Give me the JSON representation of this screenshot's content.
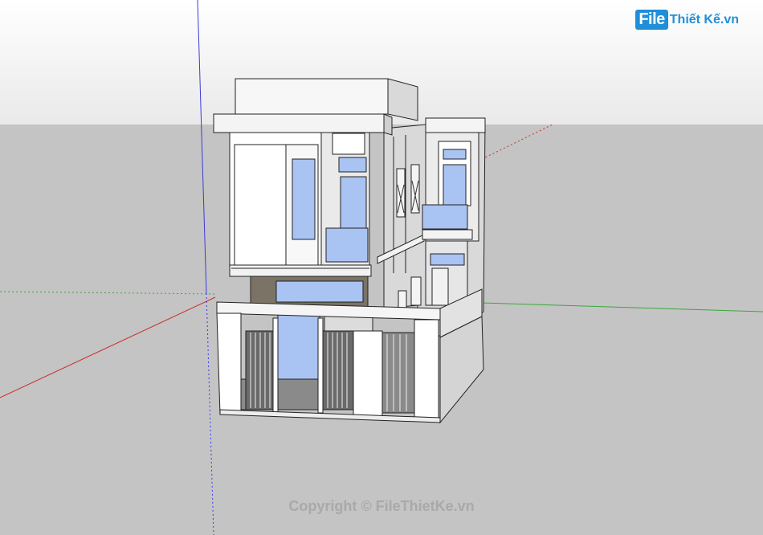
{
  "watermark": {
    "logo_mark": "File",
    "logo_rest": "Thiết Kế.vn",
    "copyright": "Copyright © FileThietKe.vn"
  },
  "colors": {
    "sky_top": "#ffffff",
    "ground": "#c4c4c4",
    "axis_red": "#cc2b2b",
    "axis_green": "#3aa83a",
    "axis_blue": "#3b3bd6",
    "wall": "#ffffff",
    "glass": "#a9c3f2",
    "stone": "#7a7366",
    "brand": "#1f8fd8"
  }
}
